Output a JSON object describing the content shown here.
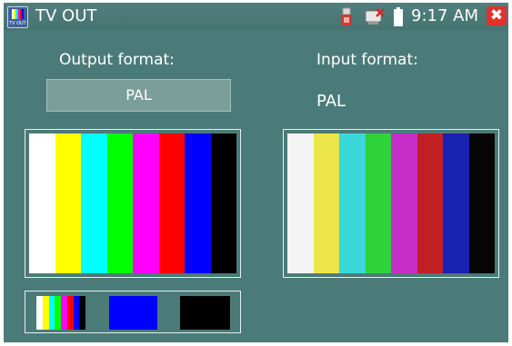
{
  "window": {
    "title": "TV OUT",
    "app_icon_text": "TV OUT",
    "close_symbol": "✖"
  },
  "status_bar": {
    "time": "9:17 AM",
    "icons": [
      "usb-icon",
      "network-disconnected-icon",
      "battery-icon"
    ]
  },
  "output": {
    "label": "Output format:",
    "format_button_label": "PAL",
    "color_bars": [
      "#ffffff",
      "#ffff00",
      "#00ffff",
      "#00ff00",
      "#ff00ff",
      "#ff0000",
      "#0000ff",
      "#000000"
    ]
  },
  "input": {
    "label": "Input format:",
    "format_value": "PAL",
    "color_bars": [
      "#f4f4f4",
      "#ece54a",
      "#3ad8d8",
      "#2ed23a",
      "#c42ec6",
      "#c21f24",
      "#1821b0",
      "#060606"
    ]
  },
  "pattern_thumbnails": [
    {
      "name": "color-bars",
      "colors": [
        "#ffffff",
        "#ffff00",
        "#00ffff",
        "#00ff00",
        "#ff00ff",
        "#ff0000",
        "#0000ff",
        "#000000"
      ]
    },
    {
      "name": "blue",
      "color": "#0000ff"
    },
    {
      "name": "black",
      "color": "#000000"
    }
  ],
  "colors": {
    "background": "#4b7b78",
    "close_button": "#e2312c"
  }
}
